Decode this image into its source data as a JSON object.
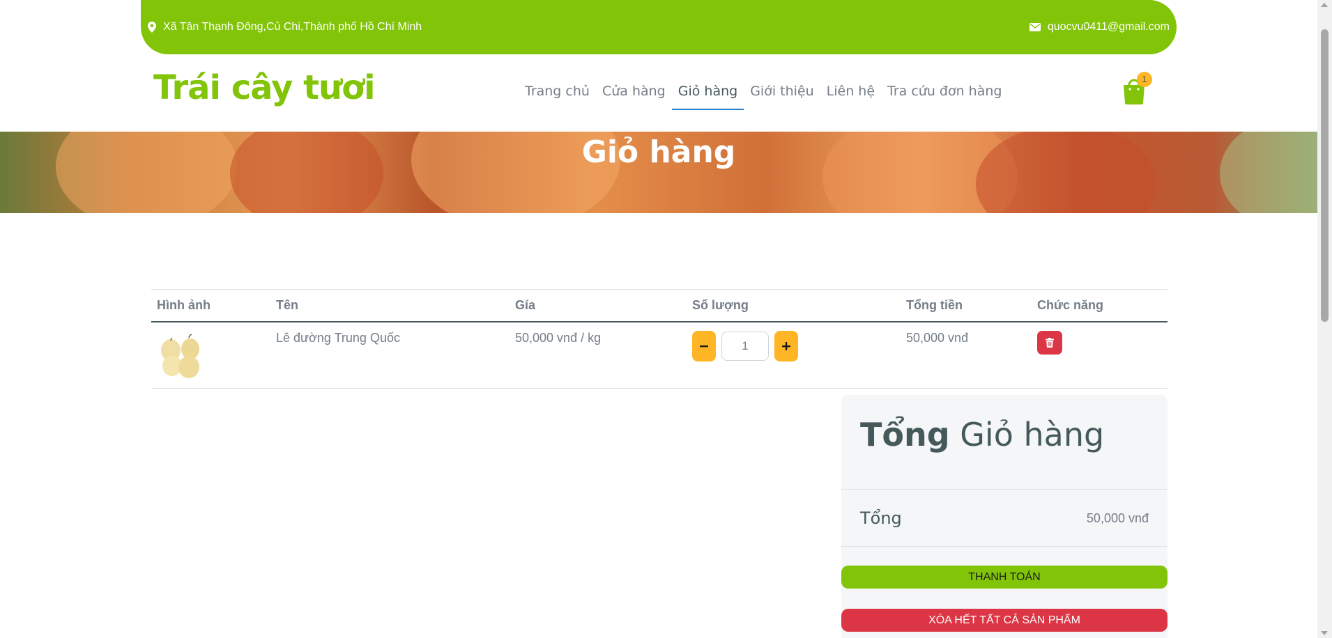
{
  "topbar": {
    "address": "Xã Tân Thạnh Đông,Củ Chi,Thành phố Hồ Chí Minh",
    "email": "quocvu0411@gmail.com"
  },
  "brand": "Trái cây tươi",
  "nav": {
    "items": [
      {
        "label": "Trang chủ"
      },
      {
        "label": "Cửa hàng"
      },
      {
        "label": "Giỏ hàng"
      },
      {
        "label": "Giới thiệu"
      },
      {
        "label": "Liên hệ"
      },
      {
        "label": "Tra cứu đơn hàng"
      }
    ],
    "active": "Giỏ hàng"
  },
  "cart_badge": "1",
  "hero": {
    "title": "Giỏ hàng"
  },
  "table": {
    "headers": [
      "Hình ảnh",
      "Tên",
      "Gía",
      "Số lượng",
      "Tổng tiền",
      "Chức năng"
    ],
    "rows": [
      {
        "name": "Lê đường Trung Quốc",
        "price": "50,000 vnđ / kg",
        "quantity": "1",
        "total": "50,000 vnđ"
      }
    ]
  },
  "summary": {
    "title_bold": "Tổng",
    "title_rest": " Giỏ hàng",
    "total_label": "Tổng",
    "total_value": "50,000 vnđ",
    "pay_label": "THANH TOÁN",
    "clear_label": "XÓA HẾT TẤT CẢ SẢN PHẨM"
  },
  "colors": {
    "primary": "#81c408",
    "secondary": "#ffb524",
    "danger": "#dc3545",
    "text": "#45595b",
    "muted": "#747d88"
  },
  "icons": [
    "map-pin-icon",
    "envelope-icon",
    "shopping-bag-icon",
    "minus-icon",
    "plus-icon",
    "trash-icon"
  ]
}
